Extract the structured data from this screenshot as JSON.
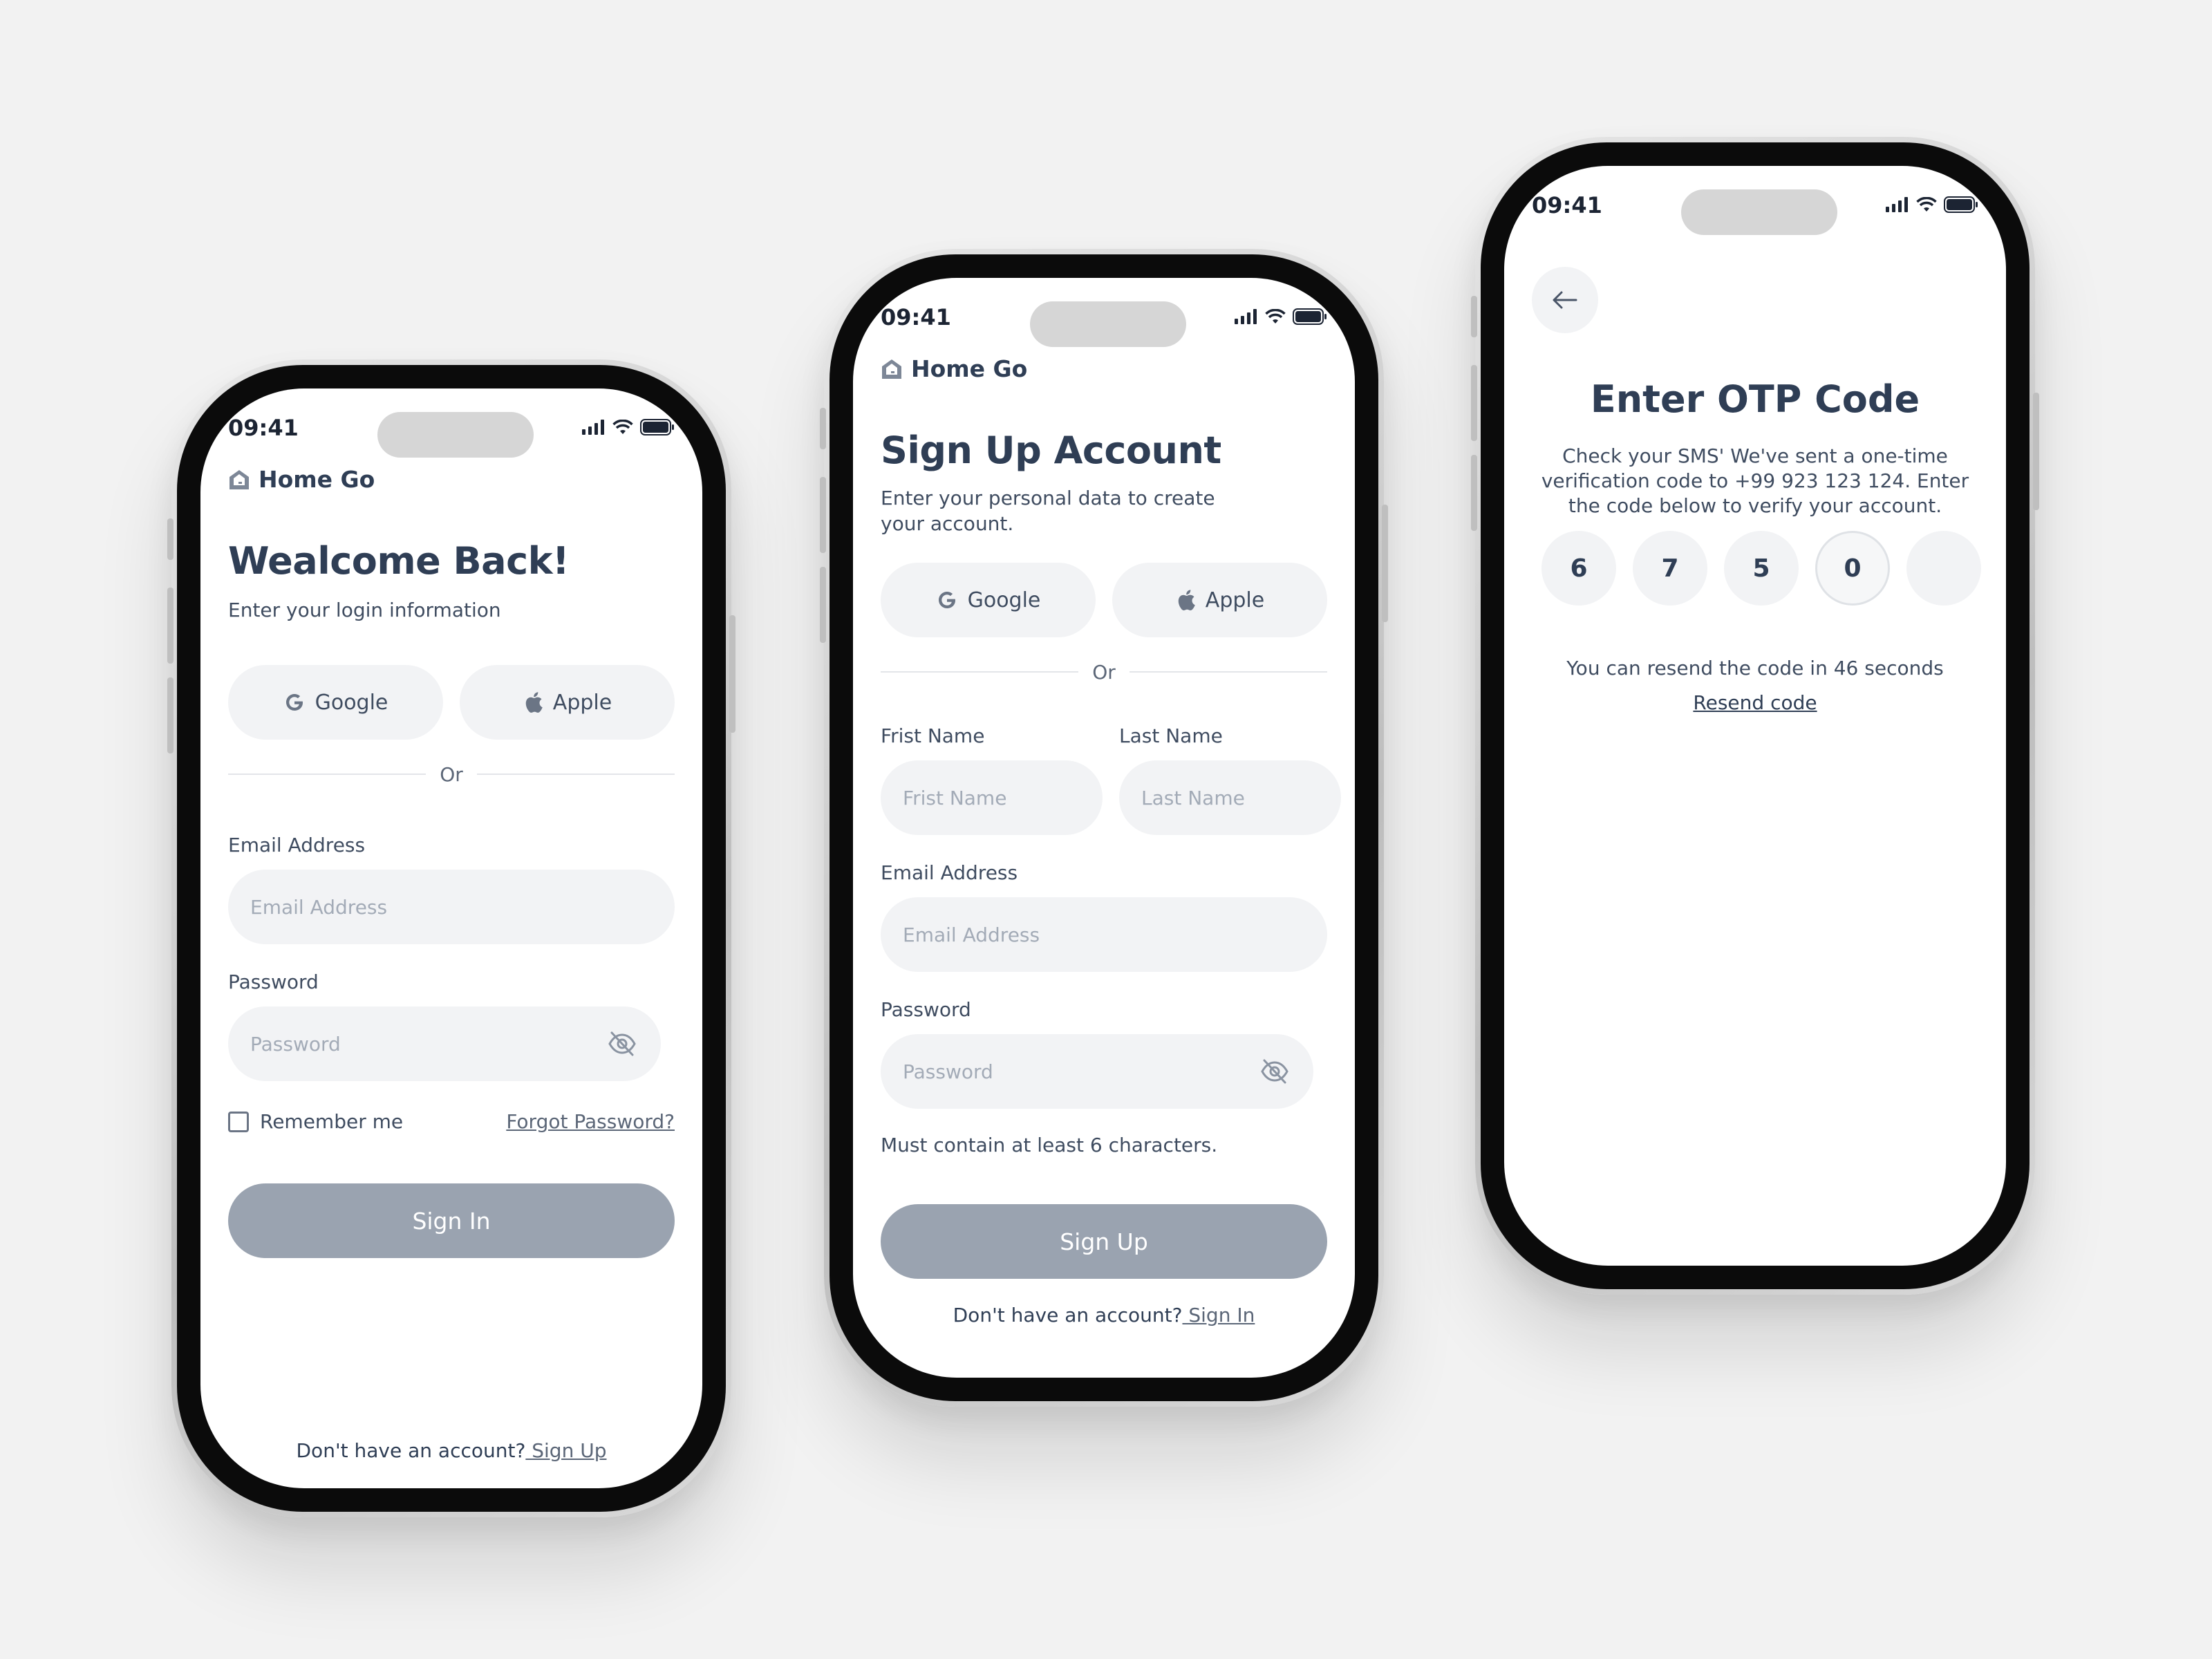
{
  "colors": {
    "background": "#f2f2f2",
    "text": "#2f3e55",
    "field": "#f2f3f5",
    "button_disabled": "#9aa3b0"
  },
  "status_bar": {
    "time": "09:41"
  },
  "brand": {
    "name": "Home Go",
    "icon": "home-go-logo-icon"
  },
  "login": {
    "title": "Wealcome Back!",
    "subtitle": "Enter your login information",
    "google_label": "Google",
    "apple_label": "Apple",
    "divider": "Or",
    "email_label": "Email Address",
    "email_placeholder": "Email Address",
    "password_label": "Password",
    "password_placeholder": "Password",
    "remember_label": "Remember me",
    "forgot_label": "Forgot Password?",
    "submit_label": "Sign In",
    "footer_text": "Don't have an account?",
    "footer_link": " Sign Up"
  },
  "signup": {
    "title": "Sign Up Account",
    "subtitle": "Enter your personal data to create your account.",
    "google_label": "Google",
    "apple_label": "Apple",
    "divider": "Or",
    "first_name_label": "Frist Name",
    "first_name_placeholder": "Frist Name",
    "last_name_label": "Last Name",
    "last_name_placeholder": "Last Name",
    "email_label": "Email Address",
    "email_placeholder": "Email Address",
    "password_label": "Password",
    "password_placeholder": "Password",
    "password_hint": "Must contain at least 6 characters.",
    "submit_label": "Sign Up",
    "footer_text": "Don't have an account?",
    "footer_link": " Sign In"
  },
  "otp": {
    "title": "Enter OTP Code",
    "description": "Check your SMS' We've sent a one-time verification code to +99 923 123 124. Enter the code below to verify your account.",
    "digits": [
      "6",
      "7",
      "5",
      "0",
      ""
    ],
    "resend_text": "You can resend the code in 46 seconds",
    "resend_link": "Resend code"
  }
}
